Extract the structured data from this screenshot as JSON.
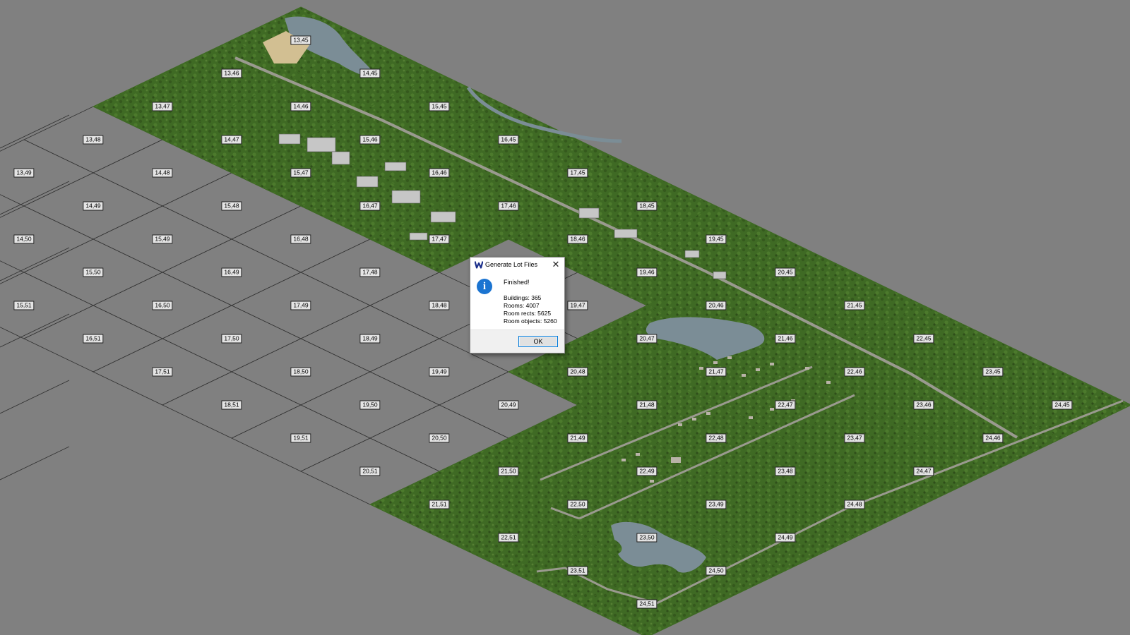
{
  "map": {
    "colors": {
      "background": "#808080",
      "grid_line": "#303030",
      "terrain": "#3f6a24",
      "water": "#7b8d96",
      "road": "#9a9a8f",
      "sand": "#d2bf92",
      "building": "#c6c6c6"
    },
    "cells": [
      {
        "label": "13,45",
        "col": 13,
        "row": 45,
        "filled": true
      },
      {
        "label": "14,45",
        "col": 14,
        "row": 45,
        "filled": true
      },
      {
        "label": "15,45",
        "col": 15,
        "row": 45,
        "filled": true
      },
      {
        "label": "16,45",
        "col": 16,
        "row": 45,
        "filled": true
      },
      {
        "label": "17,45",
        "col": 17,
        "row": 45,
        "filled": true
      },
      {
        "label": "18,45",
        "col": 18,
        "row": 45,
        "filled": true
      },
      {
        "label": "19,45",
        "col": 19,
        "row": 45,
        "filled": true
      },
      {
        "label": "20,45",
        "col": 20,
        "row": 45,
        "filled": true
      },
      {
        "label": "21,45",
        "col": 21,
        "row": 45,
        "filled": true
      },
      {
        "label": "22,45",
        "col": 22,
        "row": 45,
        "filled": true
      },
      {
        "label": "23,45",
        "col": 23,
        "row": 45,
        "filled": true
      },
      {
        "label": "24,45",
        "col": 24,
        "row": 45,
        "filled": true
      },
      {
        "label": "13,46",
        "col": 13,
        "row": 46,
        "filled": true
      },
      {
        "label": "14,46",
        "col": 14,
        "row": 46,
        "filled": true
      },
      {
        "label": "15,46",
        "col": 15,
        "row": 46,
        "filled": true
      },
      {
        "label": "16,46",
        "col": 16,
        "row": 46,
        "filled": true
      },
      {
        "label": "17,46",
        "col": 17,
        "row": 46,
        "filled": true
      },
      {
        "label": "18,46",
        "col": 18,
        "row": 46,
        "filled": true
      },
      {
        "label": "19,46",
        "col": 19,
        "row": 46,
        "filled": true
      },
      {
        "label": "20,46",
        "col": 20,
        "row": 46,
        "filled": true
      },
      {
        "label": "21,46",
        "col": 21,
        "row": 46,
        "filled": true
      },
      {
        "label": "22,46",
        "col": 22,
        "row": 46,
        "filled": true
      },
      {
        "label": "23,46",
        "col": 23,
        "row": 46,
        "filled": true
      },
      {
        "label": "24,46",
        "col": 24,
        "row": 46,
        "filled": true
      },
      {
        "label": "13,47",
        "col": 13,
        "row": 47,
        "filled": true
      },
      {
        "label": "14,47",
        "col": 14,
        "row": 47,
        "filled": true
      },
      {
        "label": "15,47",
        "col": 15,
        "row": 47,
        "filled": true
      },
      {
        "label": "16,47",
        "col": 16,
        "row": 47,
        "filled": true
      },
      {
        "label": "17,47",
        "col": 17,
        "row": 47,
        "filled": true
      },
      {
        "label": "20,47",
        "col": 20,
        "row": 47,
        "filled": true
      },
      {
        "label": "21,47",
        "col": 21,
        "row": 47,
        "filled": true
      },
      {
        "label": "22,47",
        "col": 22,
        "row": 47,
        "filled": true
      },
      {
        "label": "23,47",
        "col": 23,
        "row": 47,
        "filled": true
      },
      {
        "label": "24,47",
        "col": 24,
        "row": 47,
        "filled": true
      },
      {
        "label": "19,47",
        "col": 19,
        "row": 47,
        "filled": false
      },
      {
        "label": "13,48",
        "col": 13,
        "row": 48,
        "filled": false
      },
      {
        "label": "14,48",
        "col": 14,
        "row": 48,
        "filled": false
      },
      {
        "label": "15,48",
        "col": 15,
        "row": 48,
        "filled": false
      },
      {
        "label": "16,48",
        "col": 16,
        "row": 48,
        "filled": false
      },
      {
        "label": "17,48",
        "col": 17,
        "row": 48,
        "filled": false
      },
      {
        "label": "18,48",
        "col": 18,
        "row": 48,
        "filled": false
      },
      {
        "label": "20,48",
        "col": 20,
        "row": 48,
        "filled": true
      },
      {
        "label": "21,48",
        "col": 21,
        "row": 48,
        "filled": true
      },
      {
        "label": "22,48",
        "col": 22,
        "row": 48,
        "filled": true
      },
      {
        "label": "23,48",
        "col": 23,
        "row": 48,
        "filled": true
      },
      {
        "label": "24,48",
        "col": 24,
        "row": 48,
        "filled": true
      },
      {
        "label": "13,49",
        "col": 13,
        "row": 49,
        "filled": false
      },
      {
        "label": "14,49",
        "col": 14,
        "row": 49,
        "filled": false
      },
      {
        "label": "15,49",
        "col": 15,
        "row": 49,
        "filled": false
      },
      {
        "label": "16,49",
        "col": 16,
        "row": 49,
        "filled": false
      },
      {
        "label": "17,49",
        "col": 17,
        "row": 49,
        "filled": false
      },
      {
        "label": "18,49",
        "col": 18,
        "row": 49,
        "filled": false
      },
      {
        "label": "19,49",
        "col": 19,
        "row": 49,
        "filled": false
      },
      {
        "label": "20,49",
        "col": 20,
        "row": 49,
        "filled": false
      },
      {
        "label": "21,49",
        "col": 21,
        "row": 49,
        "filled": true
      },
      {
        "label": "22,49",
        "col": 22,
        "row": 49,
        "filled": true
      },
      {
        "label": "23,49",
        "col": 23,
        "row": 49,
        "filled": true
      },
      {
        "label": "24,49",
        "col": 24,
        "row": 49,
        "filled": true
      },
      {
        "label": "14,50",
        "col": 14,
        "row": 50,
        "filled": false
      },
      {
        "label": "15,50",
        "col": 15,
        "row": 50,
        "filled": false
      },
      {
        "label": "16,50",
        "col": 16,
        "row": 50,
        "filled": false
      },
      {
        "label": "17,50",
        "col": 17,
        "row": 50,
        "filled": false
      },
      {
        "label": "18,50",
        "col": 18,
        "row": 50,
        "filled": false
      },
      {
        "label": "19,50",
        "col": 19,
        "row": 50,
        "filled": false
      },
      {
        "label": "20,50",
        "col": 20,
        "row": 50,
        "filled": false
      },
      {
        "label": "21,50",
        "col": 21,
        "row": 50,
        "filled": true
      },
      {
        "label": "22,50",
        "col": 22,
        "row": 50,
        "filled": true
      },
      {
        "label": "23,50",
        "col": 23,
        "row": 50,
        "filled": true
      },
      {
        "label": "24,50",
        "col": 24,
        "row": 50,
        "filled": true
      },
      {
        "label": "15,51",
        "col": 15,
        "row": 51,
        "filled": false
      },
      {
        "label": "16,51",
        "col": 16,
        "row": 51,
        "filled": false
      },
      {
        "label": "17,51",
        "col": 17,
        "row": 51,
        "filled": false
      },
      {
        "label": "18,51",
        "col": 18,
        "row": 51,
        "filled": false
      },
      {
        "label": "19,51",
        "col": 19,
        "row": 51,
        "filled": false
      },
      {
        "label": "20,51",
        "col": 20,
        "row": 51,
        "filled": false
      },
      {
        "label": "21,51",
        "col": 21,
        "row": 51,
        "filled": true
      },
      {
        "label": "22,51",
        "col": 22,
        "row": 51,
        "filled": true
      },
      {
        "label": "23,51",
        "col": 23,
        "row": 51,
        "filled": true
      },
      {
        "label": "24,51",
        "col": 24,
        "row": 51,
        "filled": true
      }
    ]
  },
  "dialog": {
    "title": "Generate Lot Files",
    "close_glyph": "✕",
    "app_icon": "app-w-icon",
    "info_icon": "info-icon",
    "info_glyph": "i",
    "message": "Finished!",
    "stats": {
      "buildings": "Buildings: 365",
      "rooms": "Rooms: 4007",
      "room_rects": "Room rects: 5625",
      "room_objects": "Room objects: 5260"
    },
    "ok_label": "OK"
  }
}
